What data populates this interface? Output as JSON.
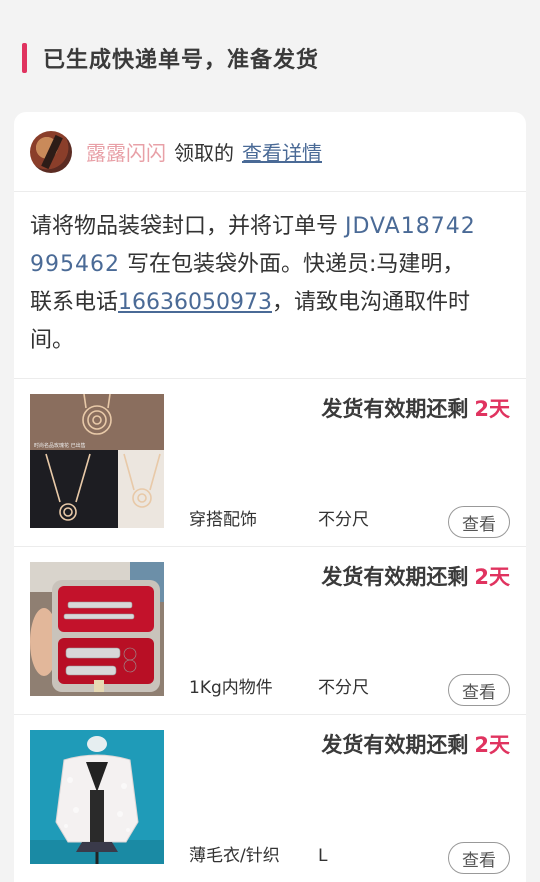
{
  "section": {
    "title": "已生成快递单号，准备发货"
  },
  "claim": {
    "user": "露露闪闪",
    "mid": "领取的",
    "link": "查看详情"
  },
  "instructions": {
    "part1": "请将物品装袋封口，并将订单号 ",
    "order_line1": "JDVA18742",
    "order_line2": "995462",
    "part2": " 写在包装袋外面。快递员:马建明，",
    "part3": "联系电话",
    "phone": "16636050973",
    "part4": "，请致电沟通取件时间。"
  },
  "items": [
    {
      "deadline_label": "发货有效期还剩",
      "days": "2天",
      "category": "穿搭配饰",
      "size": "不分尺",
      "view_label": "查看",
      "thumb_icon": "rose-necklace-photo",
      "thumb_caption": "时尚名品玫瑰花 已出售"
    },
    {
      "deadline_label": "发货有效期还剩",
      "days": "2天",
      "category": "1Kg内物件",
      "size": "不分尺",
      "view_label": "查看",
      "thumb_icon": "manicure-set-photo"
    },
    {
      "deadline_label": "发货有效期还剩",
      "days": "2天",
      "category": "薄毛衣/针织",
      "size": "L",
      "view_label": "查看",
      "thumb_icon": "white-cardigan-photo"
    }
  ],
  "colors": {
    "accent": "#e0335f",
    "link": "#4a6a96",
    "username": "#e8a0a7"
  }
}
